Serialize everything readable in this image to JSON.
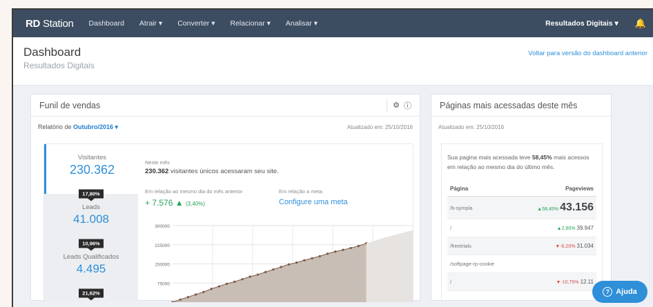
{
  "topbar": {
    "logo_bold": "RD",
    "logo_rest": " Station",
    "nav": [
      "Dashboard",
      "Atrair ▾",
      "Converter ▾",
      "Relacionar ▾",
      "Analisar ▾"
    ],
    "account": "Resultados Digitais ▾",
    "bell_icon": "bell-icon"
  },
  "header": {
    "title": "Dashboard",
    "subtitle": "Resultados Digitais",
    "back_link": "Voltar para versão do dashboard anterior"
  },
  "funnel": {
    "title": "Funil de vendas",
    "report_label": "Relatório de ",
    "report_month": "Outubro/2016 ▾",
    "updated": "Atualizado em: 25/10/2016",
    "stages": [
      {
        "name": "Visitantes",
        "value": "230.362"
      },
      {
        "name": "Leads",
        "value": "41.008"
      },
      {
        "name": "Leads Qualificados",
        "value": "4.495"
      }
    ],
    "conversions": [
      "17,80%",
      "10,96%",
      "21,62%"
    ],
    "period_label": "Neste mês",
    "summary_bold": "230.362",
    "summary_rest": " visitantes únicos acessaram seu site.",
    "prev_label": "Em relação ao mesmo dia do mês anterior",
    "growth_value": "+ 7.576 ▲",
    "growth_pct": "(3,40%)",
    "goal_label": "Em relação a meta",
    "goal_link": "Configure uma meta"
  },
  "chart_data": {
    "type": "area",
    "y_ticks": [
      "300000",
      "225000",
      "150000",
      "75000"
    ],
    "ylim": [
      0,
      300000
    ],
    "series": [
      {
        "values": [
          0,
          10000,
          20000,
          30000,
          40000,
          52000,
          62000,
          72000,
          80000,
          90000,
          100000,
          108000,
          118000,
          128000,
          138000,
          148000,
          155000,
          164000,
          172000,
          180000,
          190000,
          198000,
          205000,
          212000,
          220000,
          230362
        ]
      },
      {
        "values": [
          230362,
          240000,
          250000,
          258000,
          266000,
          274000,
          282000
        ]
      }
    ],
    "grid": true
  },
  "pages": {
    "title": "Páginas mais acessadas deste mês",
    "updated": "Atualizado em: 25/10/2016",
    "summary_pre": "Sua pagina mais acessada teve ",
    "summary_bold": "58,45%",
    "summary_post": " mais acessos em relação ao mesmo dia do último mês.",
    "col_page": "Página",
    "col_views": "Pageviews",
    "rows": [
      {
        "page": "/b-sympla",
        "change": "▲58,45%",
        "views": "43.156",
        "dir": "up"
      },
      {
        "page": "/",
        "change": "▲2,90%",
        "views": "39.947",
        "dir": "up"
      },
      {
        "page": "/freetrials",
        "change": "▼-6,20%",
        "views": "31.034",
        "dir": "down"
      },
      {
        "page": "/softpage-rp-cookie",
        "change": "",
        "views": "",
        "dir": ""
      },
      {
        "page": "/",
        "change": "▼-10,75%",
        "views": "12.11",
        "dir": "down"
      }
    ]
  },
  "help": {
    "label": "Ajuda",
    "icon": "help-icon"
  }
}
